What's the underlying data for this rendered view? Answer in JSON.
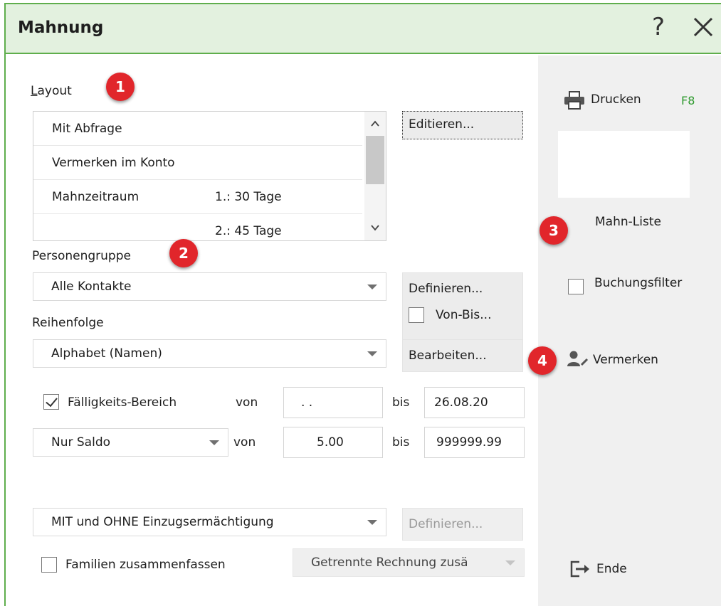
{
  "window": {
    "title": "Mahnung",
    "help_symbol": "?",
    "close_icon": "close-icon"
  },
  "layout": {
    "label": "Layout",
    "badge": "1",
    "items": [
      {
        "left": "Mit Abfrage",
        "right": ""
      },
      {
        "left": "Vermerken im Konto",
        "right": ""
      },
      {
        "left": "Mahnzeitraum",
        "right": "1.:  30 Tage"
      },
      {
        "left": "",
        "right": "2.:  45 Tage"
      }
    ],
    "edit_button": "Editieren..."
  },
  "personengruppe": {
    "label": "Personengruppe",
    "badge": "2",
    "value": "Alle Kontakte",
    "define_button": "Definieren...",
    "von_bis_label": "Von-Bis..."
  },
  "reihenfolge": {
    "label": "Reihenfolge",
    "value": "Alphabet (Namen)",
    "edit_button": "Bearbeiten..."
  },
  "faelligkeit": {
    "label": "Fälligkeits-Bereich",
    "checked": true,
    "von_label": "von",
    "von_value": " .  .",
    "bis_label": "bis",
    "bis_value": "26.08.20"
  },
  "saldo": {
    "value": "Nur Saldo",
    "von_label": "von",
    "von_value": "5.00",
    "bis_label": "bis",
    "bis_value": "999999.99"
  },
  "einzug": {
    "value": "MIT und OHNE Einzugsermächtigung",
    "define_button": "Definieren..."
  },
  "familien": {
    "label": "Familien zusammenfassen",
    "checked": false,
    "rechnung_value": "Getrennte Rechnung zusä"
  },
  "sidebar": {
    "print_label": "Drucken",
    "print_shortcut": "F8",
    "mahn_liste_label": "Mahn-Liste",
    "badge_3": "3",
    "buchungsfilter_label": "Buchungsfilter",
    "vermerken_label": "Vermerken",
    "badge_4": "4",
    "ende_label": "Ende"
  },
  "colors": {
    "title_bg": "#e3f1df",
    "accent_border": "#5fae4c",
    "badge": "#e1262b",
    "shortcut": "#2e9a2e"
  }
}
